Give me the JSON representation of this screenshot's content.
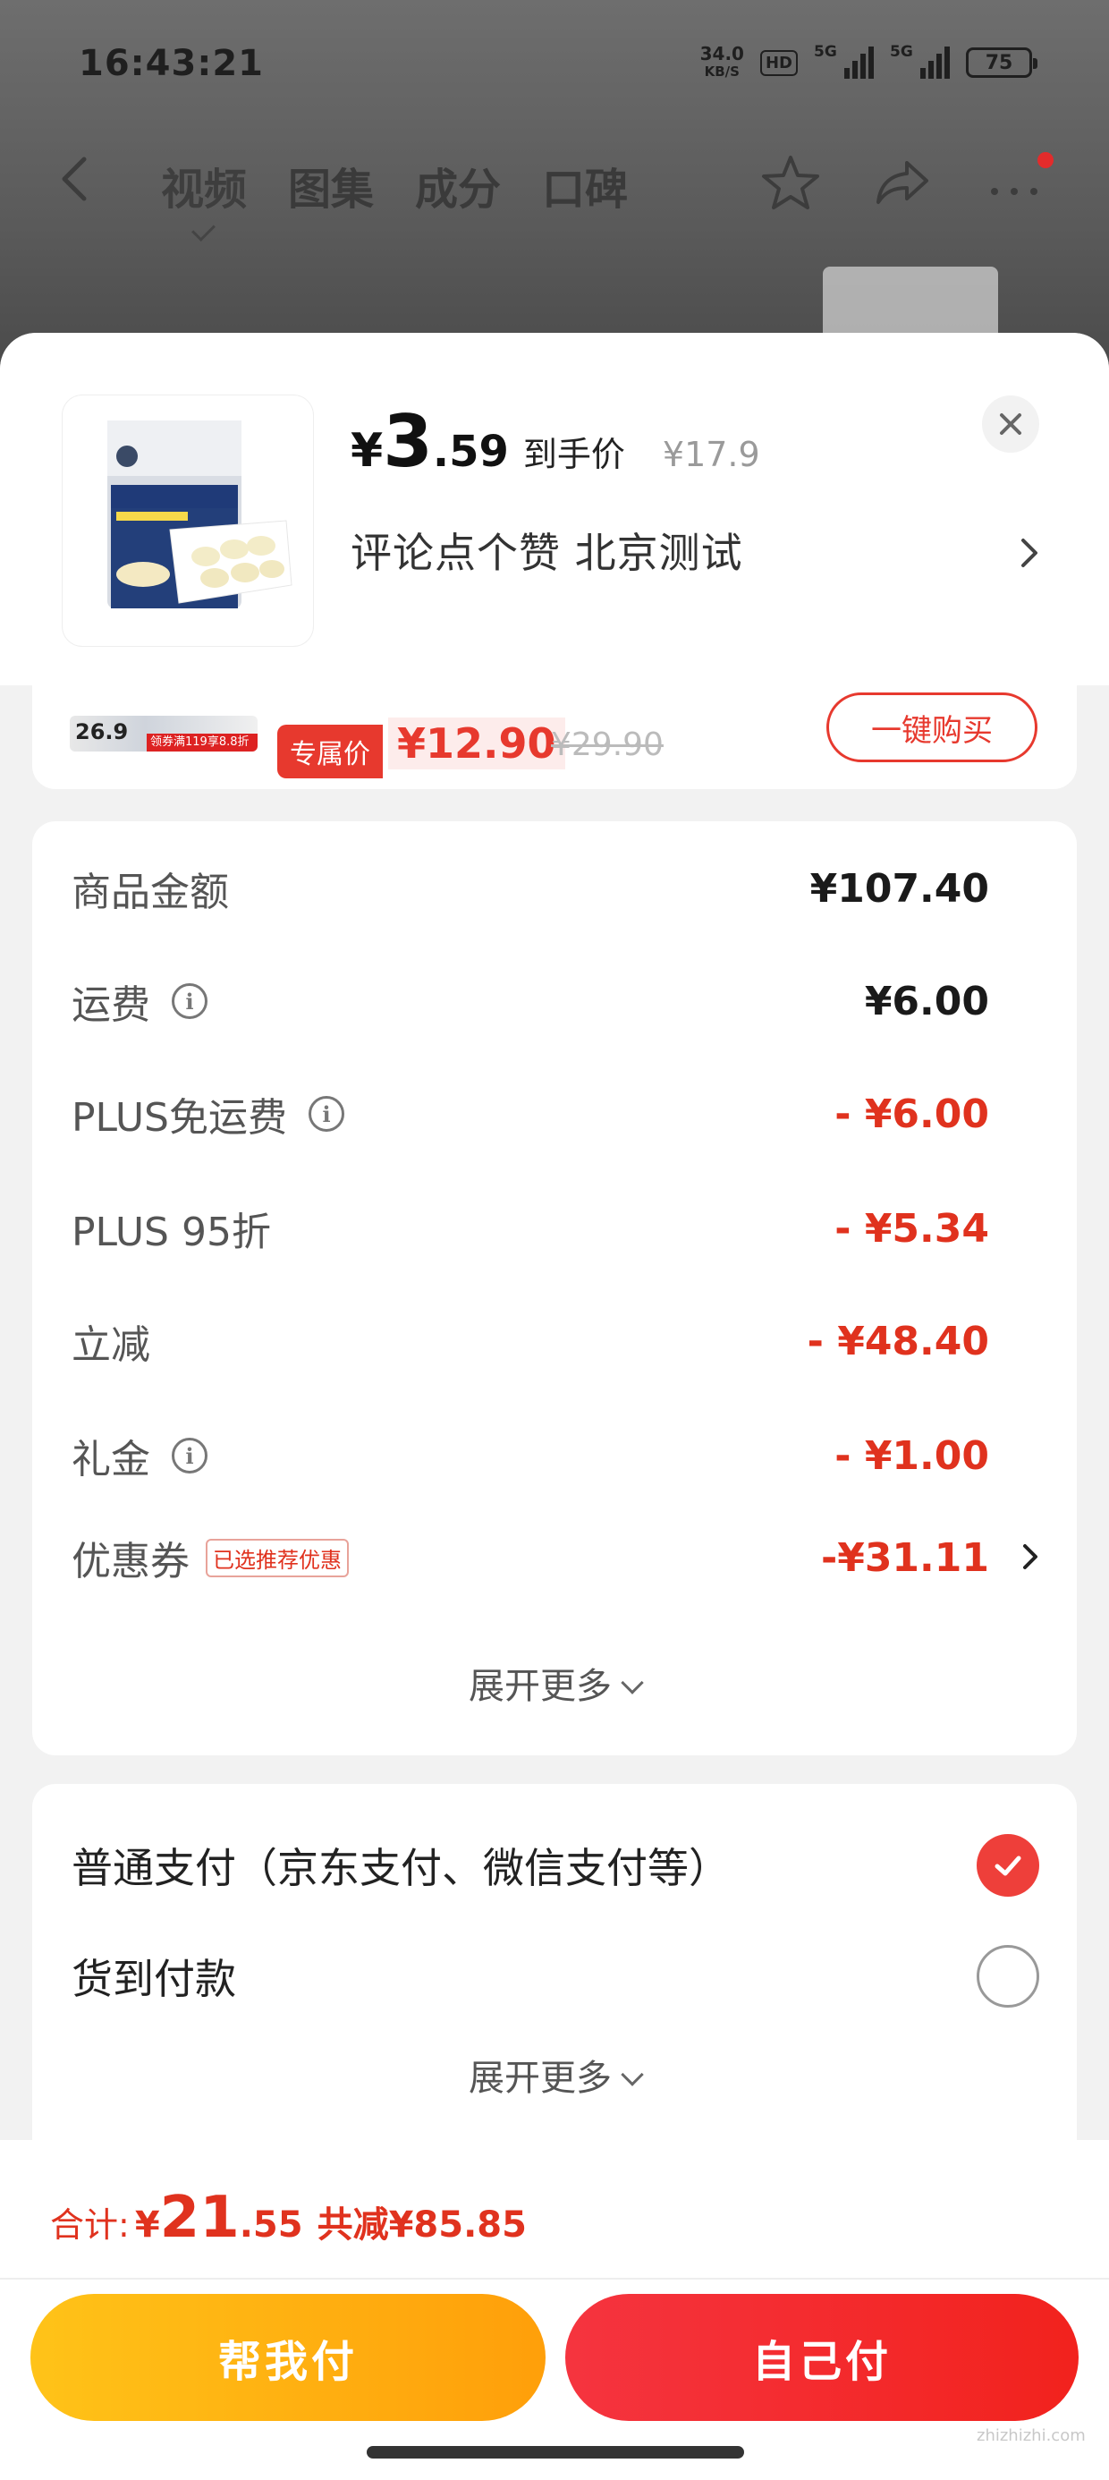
{
  "status": {
    "time": "16:43:21",
    "net_speed": "34.0",
    "net_unit": "KB/S",
    "hd": "HD",
    "sig1_label": "5G",
    "sig2_label": "5G",
    "battery": "75"
  },
  "nav": {
    "tabs": [
      "视频",
      "图集",
      "成分",
      "口碑"
    ]
  },
  "product": {
    "price_symbol": "¥",
    "price_int": "3",
    "price_dec": ".59",
    "price_tag": "到手价",
    "orig_price": "¥17.9",
    "selection": "评论点个赞  北京测试"
  },
  "partial_item": {
    "thumb_num": "26.9",
    "thumb_strip": "领券满119享8.8折",
    "excl_label": "专属价",
    "excl_price": "¥12.90",
    "excl_orig": "¥29.90",
    "buy_label": "一键购买"
  },
  "summary": {
    "rows": [
      {
        "label": "商品金额",
        "value": "¥107.40"
      },
      {
        "label": "运费",
        "value": "¥6.00"
      },
      {
        "label": "PLUS免运费",
        "value": "- ¥6.00"
      },
      {
        "label": "PLUS 95折",
        "value": "- ¥5.34"
      },
      {
        "label": "立减",
        "value": "- ¥48.40"
      },
      {
        "label": "礼金",
        "value": "- ¥1.00"
      },
      {
        "label": "优惠券",
        "value": "-¥31.11"
      }
    ],
    "coupon_tag": "已选推荐优惠",
    "info_glyph": "i",
    "expand_label": "展开更多"
  },
  "payment": {
    "options": [
      "普通支付（京东支付、微信支付等）",
      "货到付款"
    ],
    "expand_label": "展开更多"
  },
  "footer": {
    "total_label": "合计:",
    "total_sym": "¥",
    "total_int": "21",
    "total_dec": ".55",
    "total_saved": "共减¥85.85",
    "help_pay": "帮我付",
    "self_pay": "自己付"
  },
  "watermark": "zhizhizhi.com",
  "colors": {
    "accent_red": "#e0321e",
    "help_btn_start": "#ffc318",
    "help_btn_end": "#ff9f0a",
    "self_btn": "#f2221d"
  }
}
